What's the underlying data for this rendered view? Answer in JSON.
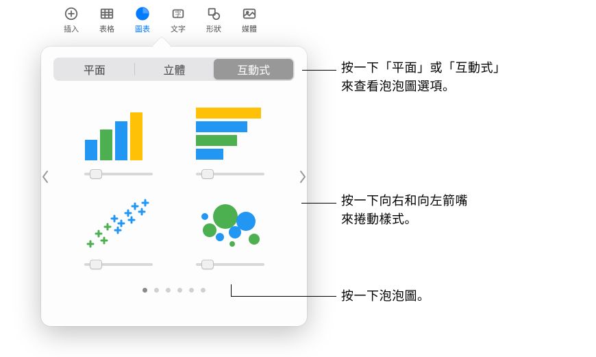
{
  "toolbar": {
    "insert": "插入",
    "table": "表格",
    "chart": "圖表",
    "text": "文字",
    "shape": "形狀",
    "media": "媒體"
  },
  "segments": {
    "flat": "平面",
    "threed": "立體",
    "interactive": "互動式"
  },
  "callouts": {
    "tabs_line1": "按一下「平面」或「互動式」",
    "tabs_line2": "來查看泡泡圖選項。",
    "arrows_line1": "按一下向右和向左箭嘴",
    "arrows_line2": "來捲動樣式。",
    "bubble": "按一下泡泡圖。"
  },
  "charts": {
    "bar": "interactive-bar-chart",
    "hbar": "interactive-horizontal-bar-chart",
    "scatter": "interactive-scatter-chart",
    "bubble": "interactive-bubble-chart"
  },
  "colors": {
    "blue": "#2196F3",
    "green": "#4CAF50",
    "yellow": "#FFC107"
  }
}
